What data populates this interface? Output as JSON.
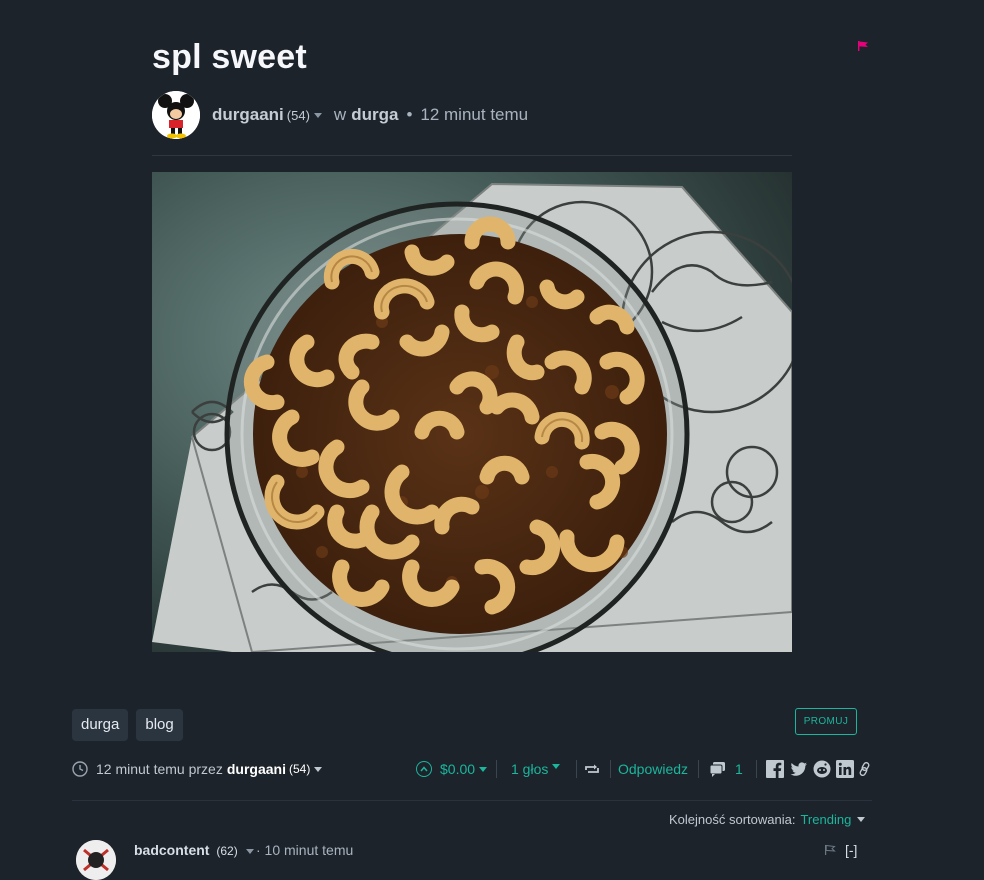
{
  "post": {
    "title": "spl sweet",
    "author": "durgaani",
    "reputation": "(54)",
    "in_label": "w",
    "community": "durga",
    "separator": "•",
    "time_ago": "12 minut temu",
    "image_alt": "sweet dish topped with cashews in a glass bowl"
  },
  "tags": [
    "durga",
    "blog"
  ],
  "promote_label": "PROMUJ",
  "footer": {
    "posted_text": "12 minut temu przez",
    "author": "durgaani",
    "reputation": "(54)",
    "payout": "$0.00",
    "votes": "1 głos",
    "reply_label": "Odpowiedz",
    "comment_count": "1"
  },
  "sort": {
    "label": "Kolejność sortowania:",
    "value": "Trending"
  },
  "comment": {
    "author": "badcontent",
    "reputation": "(62)",
    "time_ago": "· 10 minut temu",
    "collapse_label": "[-]"
  },
  "colors": {
    "background": "#1d232a",
    "accent": "#1ab69e",
    "flag": "#e6007a"
  },
  "icons": [
    "flag-icon",
    "clock-icon",
    "upvote-icon",
    "resteem-icon",
    "comments-icon",
    "facebook-icon",
    "twitter-icon",
    "reddit-icon",
    "linkedin-icon",
    "link-icon"
  ]
}
